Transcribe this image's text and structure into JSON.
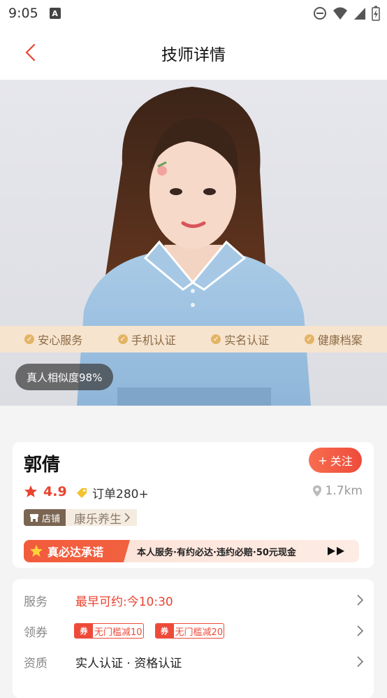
{
  "status": {
    "time": "9:05",
    "a_label": "A"
  },
  "nav": {
    "title": "技师详情"
  },
  "hero": {
    "similarity": "真人相似度98%"
  },
  "badges": [
    "安心服务",
    "手机认证",
    "实名认证",
    "健康档案"
  ],
  "profile": {
    "name": "郭倩",
    "follow_label": "关注",
    "follow_plus": "+",
    "rating": "4.9",
    "orders": "订单280+",
    "distance": "1.7km",
    "shop_tag": "店铺",
    "shop_name": "康乐养生",
    "promise_title": "真必达承诺",
    "promise_text": "本人服务·有约必达·违约必赔·50元现金"
  },
  "details": {
    "service_label": "服务",
    "service_value": "最早可约:今10:30",
    "coupon_label": "领券",
    "coupon_badge": "券",
    "coupons": [
      "无门槛减10",
      "无门槛减20"
    ],
    "qual_label": "资质",
    "qual_value": "实人认证 · 资格认证"
  },
  "colors": {
    "accent": "#ee4a3a",
    "gold": "#e4b466",
    "badge_bg": "#f7e4cf"
  }
}
